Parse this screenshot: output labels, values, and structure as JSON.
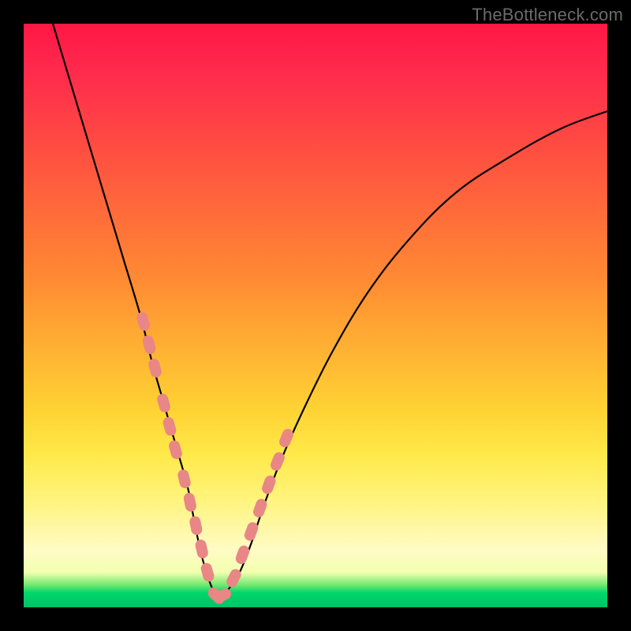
{
  "watermark": "TheBottleneck.com",
  "colors": {
    "frame": "#000000",
    "curve": "#000000",
    "bead": "#e98686",
    "gradient_stops": [
      "#ff1744",
      "#ff6a3a",
      "#ffd233",
      "#fffbc4",
      "#00c267"
    ]
  },
  "chart_data": {
    "type": "line",
    "title": "",
    "xlabel": "",
    "ylabel": "",
    "xlim": [
      0,
      100
    ],
    "ylim": [
      0,
      100
    ],
    "series": [
      {
        "name": "bottleneck-curve",
        "x": [
          5,
          8,
          11,
          14,
          17,
          20,
          22,
          24,
          26,
          28,
          29,
          30,
          31,
          32,
          33,
          34,
          35,
          37,
          39,
          41,
          44,
          48,
          53,
          59,
          66,
          74,
          83,
          92,
          100
        ],
        "values": [
          100,
          90,
          80,
          70,
          60,
          50,
          42,
          35,
          28,
          21,
          16,
          11,
          7,
          4,
          2,
          2,
          3,
          6,
          11,
          17,
          25,
          34,
          44,
          54,
          63,
          71,
          77,
          82,
          85
        ]
      }
    ],
    "markers": {
      "name": "beads",
      "x": [
        20.5,
        21.5,
        22.5,
        24.0,
        25.0,
        26.0,
        27.5,
        28.5,
        29.5,
        30.5,
        31.5,
        33.0,
        34.0,
        36.0,
        37.5,
        39.0,
        40.5,
        42.0,
        43.5,
        45.0
      ],
      "values": [
        49,
        45,
        41,
        35,
        31,
        27,
        22,
        18,
        14,
        10,
        6,
        2,
        2,
        5,
        9,
        13,
        17,
        21,
        25,
        29
      ]
    }
  }
}
